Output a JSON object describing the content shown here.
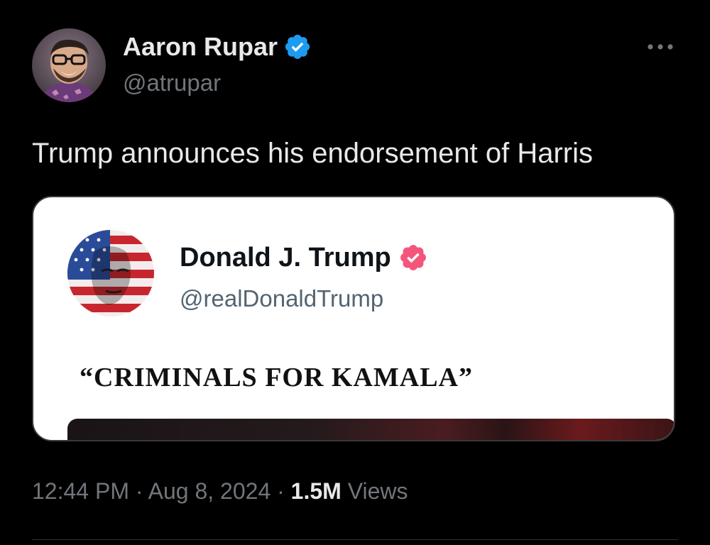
{
  "tweet": {
    "author_name": "Aaron Rupar",
    "author_handle": "@atrupar",
    "text": "Trump announces his endorsement of Harris",
    "more_icon": "more-horizontal-icon",
    "verified_icon": "verified-badge-icon",
    "verified_color": "#1d9bf0"
  },
  "embed": {
    "author_name": "Donald J. Trump",
    "author_handle": "@realDonaldTrump",
    "text": "“CRIMINALS FOR KAMALA”",
    "verified_color": "#f4567b"
  },
  "meta": {
    "time": "12:44 PM",
    "separator": "·",
    "date": "Aug 8, 2024",
    "views_count": "1.5M",
    "views_label": "Views"
  }
}
